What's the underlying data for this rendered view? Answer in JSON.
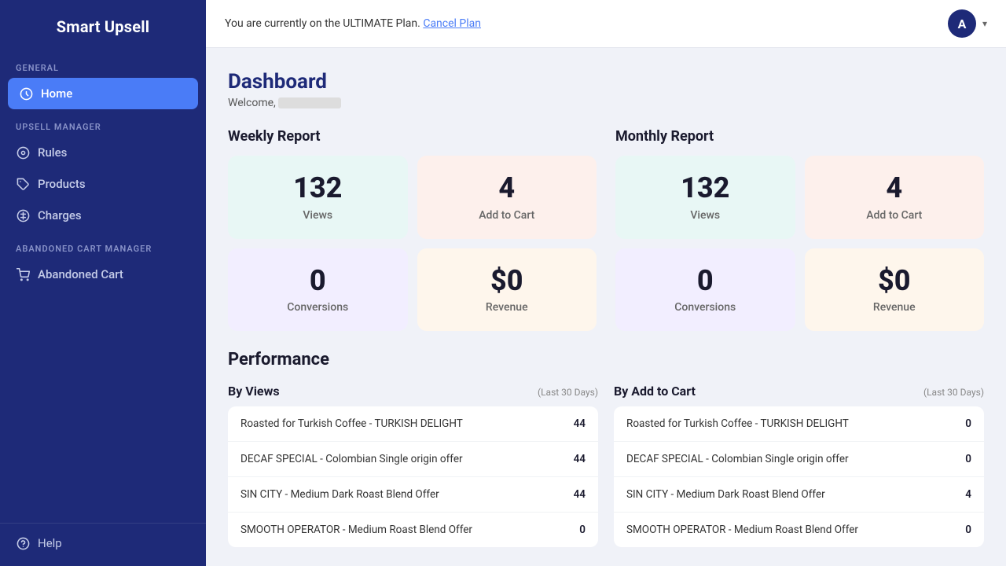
{
  "sidebar": {
    "logo": "Smart Upsell",
    "sections": [
      {
        "label": "GENERAL",
        "items": [
          {
            "id": "home",
            "label": "Home",
            "icon": "⊕",
            "active": true
          }
        ]
      },
      {
        "label": "UPSELL MANAGER",
        "items": [
          {
            "id": "rules",
            "label": "Rules",
            "icon": "◉",
            "active": false
          },
          {
            "id": "products",
            "label": "Products",
            "icon": "🏷",
            "active": false
          },
          {
            "id": "charges",
            "label": "Charges",
            "icon": "💰",
            "active": false
          }
        ]
      },
      {
        "label": "ABANDONED CART MANAGER",
        "items": [
          {
            "id": "abandoned-cart",
            "label": "Abandoned Cart",
            "icon": "🛒",
            "active": false
          }
        ]
      }
    ],
    "help_label": "Help"
  },
  "topbar": {
    "plan_text": "You are currently on the ULTIMATE Plan.",
    "cancel_link": "Cancel Plan",
    "avatar_letter": "A"
  },
  "dashboard": {
    "title": "Dashboard",
    "welcome_prefix": "Welcome, "
  },
  "weekly_report": {
    "title": "Weekly Report",
    "stats": [
      {
        "value": "132",
        "label": "Views",
        "color": "teal"
      },
      {
        "value": "4",
        "label": "Add to Cart",
        "color": "peach"
      },
      {
        "value": "0",
        "label": "Conversions",
        "color": "lavender"
      },
      {
        "value": "$0",
        "label": "Revenue",
        "color": "cream"
      }
    ]
  },
  "monthly_report": {
    "title": "Monthly Report",
    "stats": [
      {
        "value": "132",
        "label": "Views",
        "color": "teal"
      },
      {
        "value": "4",
        "label": "Add to Cart",
        "color": "peach"
      },
      {
        "value": "0",
        "label": "Conversions",
        "color": "lavender"
      },
      {
        "value": "$0",
        "label": "Revenue",
        "color": "cream"
      }
    ]
  },
  "performance": {
    "title": "Performance",
    "by_views": {
      "title": "By Views",
      "period": "(Last 30 Days)",
      "rows": [
        {
          "name": "Roasted for Turkish Coffee - TURKISH DELIGHT",
          "value": "44"
        },
        {
          "name": "DECAF SPECIAL - Colombian Single origin offer",
          "value": "44"
        },
        {
          "name": "SIN CITY - Medium Dark Roast Blend Offer",
          "value": "44"
        },
        {
          "name": "SMOOTH OPERATOR - Medium Roast Blend Offer",
          "value": "0"
        }
      ]
    },
    "by_add_to_cart": {
      "title": "By Add to Cart",
      "period": "(Last 30 Days)",
      "rows": [
        {
          "name": "Roasted for Turkish Coffee - TURKISH DELIGHT",
          "value": "0"
        },
        {
          "name": "DECAF SPECIAL - Colombian Single origin offer",
          "value": "0"
        },
        {
          "name": "SIN CITY - Medium Dark Roast Blend Offer",
          "value": "4"
        },
        {
          "name": "SMOOTH OPERATOR - Medium Roast Blend Offer",
          "value": "0"
        }
      ]
    }
  }
}
